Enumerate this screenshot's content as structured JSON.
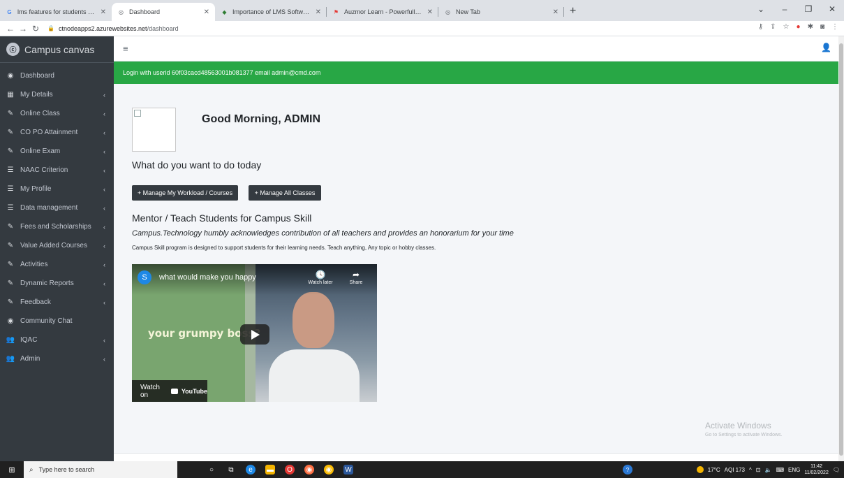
{
  "browser": {
    "tabs": [
      {
        "title": "lms features for students - Goog",
        "icon": "google-icon",
        "color": "#4285f4"
      },
      {
        "title": "Dashboard",
        "icon": "globe-icon",
        "color": "#5f6368",
        "active": true
      },
      {
        "title": "Importance of LMS Software Du",
        "icon": "diamond-icon",
        "color": "#2e7d32"
      },
      {
        "title": "Auzmor Learn - Powerfully Simpl",
        "icon": "flag-icon",
        "color": "#e53935"
      },
      {
        "title": "New Tab",
        "icon": "globe-icon",
        "color": "#5f6368"
      }
    ],
    "url_host": "ctnodeapps2.azurewebsites.net",
    "url_path": "/dashboard"
  },
  "sidebar": {
    "brand": "Campus canvas",
    "items": [
      {
        "label": "Dashboard",
        "icon": "tachometer-icon",
        "glyph": "◉",
        "has_arrow": false
      },
      {
        "label": "My Details",
        "icon": "grid-icon",
        "glyph": "▦",
        "has_arrow": true
      },
      {
        "label": "Online Class",
        "icon": "edit-icon",
        "glyph": "✎",
        "has_arrow": true
      },
      {
        "label": "CO PO Attainment",
        "icon": "edit-icon",
        "glyph": "✎",
        "has_arrow": true
      },
      {
        "label": "Online Exam",
        "icon": "edit-icon",
        "glyph": "✎",
        "has_arrow": true
      },
      {
        "label": "NAAC Criterion",
        "icon": "list-icon",
        "glyph": "☰",
        "has_arrow": true
      },
      {
        "label": "My Profile",
        "icon": "list-icon",
        "glyph": "☰",
        "has_arrow": true
      },
      {
        "label": "Data management",
        "icon": "list-icon",
        "glyph": "☰",
        "has_arrow": true
      },
      {
        "label": "Fees and Scholarships",
        "icon": "edit-icon",
        "glyph": "✎",
        "has_arrow": true
      },
      {
        "label": "Value Added Courses",
        "icon": "edit-icon",
        "glyph": "✎",
        "has_arrow": true
      },
      {
        "label": "Activities",
        "icon": "edit-icon",
        "glyph": "✎",
        "has_arrow": true
      },
      {
        "label": "Dynamic Reports",
        "icon": "edit-icon",
        "glyph": "✎",
        "has_arrow": true
      },
      {
        "label": "Feedback",
        "icon": "edit-icon",
        "glyph": "✎",
        "has_arrow": true
      },
      {
        "label": "Community Chat",
        "icon": "tachometer-icon",
        "glyph": "◉",
        "has_arrow": false
      },
      {
        "label": "IQAC",
        "icon": "users-icon",
        "glyph": "👥",
        "has_arrow": true
      },
      {
        "label": "Admin",
        "icon": "users-icon",
        "glyph": "👥",
        "has_arrow": true
      }
    ]
  },
  "alert": {
    "text": "Login with userid 60f03cacd48563001b081377 email admin@cmd.com",
    "color": "#28a745"
  },
  "main": {
    "greeting": "Good Morning, ADMIN",
    "question": "What do you want to do today",
    "btn_workload": "+ Manage My Workload / Courses",
    "btn_classes": "+ Manage All Classes",
    "mentor_title": "Mentor / Teach Students for Campus Skill",
    "acknowledgement": "Campus.Technology humbly acknowledges contribution of all teachers and provides an honorarium for your time",
    "description": "Campus Skill program is designed to support students for their learning needs. Teach anything, Any topic or hobby classes."
  },
  "video": {
    "channel_initial": "S",
    "title": "what would make you happy",
    "watch_later": "Watch later",
    "share": "Share",
    "caption": "your grumpy boss?",
    "watch_on": "Watch on",
    "youtube": "YouTube"
  },
  "watermark": {
    "title": "Activate Windows",
    "subtitle": "Go to Settings to activate Windows."
  },
  "taskbar": {
    "search_placeholder": "Type here to search",
    "weather": "17°C",
    "aqi": "AQI 173",
    "lang": "ENG",
    "time": "11:42",
    "date": "11/02/2022"
  }
}
